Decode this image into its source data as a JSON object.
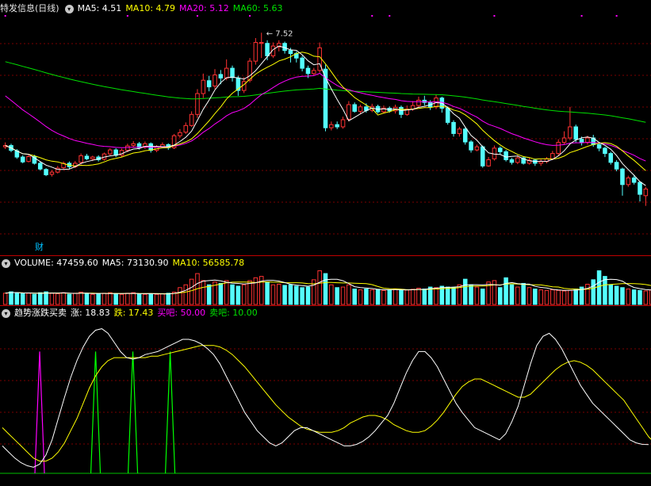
{
  "colors": {
    "up": "#ff3232",
    "down": "#54ffff",
    "ma5": "#ffffff",
    "ma10": "#ffff00",
    "ma20": "#ff00ff",
    "ma60": "#00e000",
    "grid": "#7a0000",
    "kdj_j": "#ffffff",
    "kdj_k": "#ffff00",
    "buy": "#ff00ff",
    "sell": "#00ff00"
  },
  "panel1": {
    "stock_title": "特发信息(日线)",
    "indicators": [
      {
        "label": "MA5: 4.51",
        "color": "#ffffff"
      },
      {
        "label": "MA10: 4.79",
        "color": "#ffff00"
      },
      {
        "label": "MA20: 5.12",
        "color": "#ff00ff"
      },
      {
        "label": "MA60: 5.63",
        "color": "#00e000"
      }
    ],
    "peak_label": "7.52",
    "cai_label": "财"
  },
  "panel2": {
    "indicators": [
      {
        "label": "VOLUME: 47459.60",
        "color": "#ffffff"
      },
      {
        "label": "MA5: 73130.90",
        "color": "#ffffff"
      },
      {
        "label": "MA10: 56585.78",
        "color": "#ffff00"
      }
    ]
  },
  "panel3": {
    "indicators": [
      {
        "label": "趋势涨跌买卖",
        "color": "#ffffff"
      },
      {
        "label": "涨: 18.83",
        "color": "#ffffff"
      },
      {
        "label": "跌: 17.43",
        "color": "#ffff00"
      },
      {
        "label": "买吧: 50.00",
        "color": "#ff00ff"
      },
      {
        "label": "卖吧: 10.00",
        "color": "#00e000"
      }
    ]
  },
  "chart_data": [
    {
      "type": "candlestick",
      "price_range": [
        2.9,
        7.9
      ],
      "candles": [
        {
          "o": 4.95,
          "c": 4.98,
          "h": 5.05,
          "l": 4.9
        },
        {
          "o": 4.98,
          "c": 4.87,
          "h": 5.02,
          "l": 4.83
        },
        {
          "o": 4.86,
          "c": 4.72,
          "h": 4.9,
          "l": 4.68
        },
        {
          "o": 4.72,
          "c": 4.61,
          "h": 4.76,
          "l": 4.58
        },
        {
          "o": 4.62,
          "c": 4.73,
          "h": 4.78,
          "l": 4.6
        },
        {
          "o": 4.73,
          "c": 4.58,
          "h": 4.77,
          "l": 4.55
        },
        {
          "o": 4.58,
          "c": 4.45,
          "h": 4.62,
          "l": 4.42
        },
        {
          "o": 4.44,
          "c": 4.32,
          "h": 4.47,
          "l": 4.29
        },
        {
          "o": 4.33,
          "c": 4.38,
          "h": 4.43,
          "l": 4.28
        },
        {
          "o": 4.38,
          "c": 4.47,
          "h": 4.52,
          "l": 4.35
        },
        {
          "o": 4.48,
          "c": 4.58,
          "h": 4.62,
          "l": 4.45
        },
        {
          "o": 4.58,
          "c": 4.5,
          "h": 4.62,
          "l": 4.44
        },
        {
          "o": 4.5,
          "c": 4.58,
          "h": 4.63,
          "l": 4.47
        },
        {
          "o": 4.6,
          "c": 4.75,
          "h": 4.8,
          "l": 4.55
        },
        {
          "o": 4.74,
          "c": 4.68,
          "h": 4.79,
          "l": 4.65
        },
        {
          "o": 4.68,
          "c": 4.72,
          "h": 4.75,
          "l": 4.63
        },
        {
          "o": 4.72,
          "c": 4.66,
          "h": 4.76,
          "l": 4.62
        },
        {
          "o": 4.67,
          "c": 4.79,
          "h": 4.82,
          "l": 4.64
        },
        {
          "o": 4.79,
          "c": 4.88,
          "h": 4.92,
          "l": 4.76
        },
        {
          "o": 4.88,
          "c": 4.76,
          "h": 4.92,
          "l": 4.72
        },
        {
          "o": 4.76,
          "c": 4.87,
          "h": 4.91,
          "l": 4.72
        },
        {
          "o": 4.87,
          "c": 4.97,
          "h": 5.02,
          "l": 4.83
        },
        {
          "o": 4.98,
          "c": 5.02,
          "h": 5.08,
          "l": 4.94
        },
        {
          "o": 5.02,
          "c": 4.93,
          "h": 5.06,
          "l": 4.89
        },
        {
          "o": 4.94,
          "c": 5.02,
          "h": 5.07,
          "l": 4.9
        },
        {
          "o": 5.02,
          "c": 4.87,
          "h": 5.05,
          "l": 4.82
        },
        {
          "o": 4.87,
          "c": 4.95,
          "h": 4.99,
          "l": 4.83
        },
        {
          "o": 4.95,
          "c": 5.0,
          "h": 5.05,
          "l": 4.93
        },
        {
          "o": 5.0,
          "c": 4.93,
          "h": 5.03,
          "l": 4.88
        },
        {
          "o": 4.93,
          "c": 5.2,
          "h": 5.24,
          "l": 4.9
        },
        {
          "o": 5.2,
          "c": 5.27,
          "h": 5.35,
          "l": 5.15
        },
        {
          "o": 5.28,
          "c": 5.43,
          "h": 5.5,
          "l": 5.24
        },
        {
          "o": 5.43,
          "c": 5.68,
          "h": 5.75,
          "l": 5.4
        },
        {
          "o": 5.68,
          "c": 6.15,
          "h": 6.25,
          "l": 5.6
        },
        {
          "o": 6.15,
          "c": 6.45,
          "h": 6.6,
          "l": 6.05
        },
        {
          "o": 6.44,
          "c": 6.3,
          "h": 6.55,
          "l": 6.2
        },
        {
          "o": 6.32,
          "c": 6.57,
          "h": 6.7,
          "l": 6.25
        },
        {
          "o": 6.58,
          "c": 6.5,
          "h": 6.68,
          "l": 6.36
        },
        {
          "o": 6.5,
          "c": 6.72,
          "h": 6.92,
          "l": 6.45
        },
        {
          "o": 6.72,
          "c": 6.51,
          "h": 6.78,
          "l": 6.42
        },
        {
          "o": 6.5,
          "c": 6.22,
          "h": 6.55,
          "l": 6.1
        },
        {
          "o": 6.22,
          "c": 6.42,
          "h": 6.52,
          "l": 6.16
        },
        {
          "o": 6.45,
          "c": 6.88,
          "h": 6.95,
          "l": 6.4
        },
        {
          "o": 6.88,
          "c": 7.3,
          "h": 7.4,
          "l": 6.8
        },
        {
          "o": 7.28,
          "c": 7.3,
          "h": 7.52,
          "l": 6.95
        },
        {
          "o": 7.28,
          "c": 7.0,
          "h": 7.35,
          "l": 6.9
        },
        {
          "o": 7.0,
          "c": 7.22,
          "h": 7.3,
          "l": 6.95
        },
        {
          "o": 7.2,
          "c": 7.28,
          "h": 7.35,
          "l": 7.1
        },
        {
          "o": 7.28,
          "c": 7.12,
          "h": 7.32,
          "l": 7.05
        },
        {
          "o": 7.12,
          "c": 7.05,
          "h": 7.18,
          "l": 6.85
        },
        {
          "o": 7.05,
          "c": 6.95,
          "h": 7.1,
          "l": 6.85
        },
        {
          "o": 6.95,
          "c": 6.72,
          "h": 7.0,
          "l": 6.65
        },
        {
          "o": 6.72,
          "c": 6.6,
          "h": 6.78,
          "l": 6.5
        },
        {
          "o": 6.6,
          "c": 6.67,
          "h": 6.73,
          "l": 6.55
        },
        {
          "o": 6.67,
          "c": 7.18,
          "h": 7.3,
          "l": 6.62
        },
        {
          "o": 6.7,
          "c": 5.38,
          "h": 6.8,
          "l": 5.3
        },
        {
          "o": 5.38,
          "c": 5.45,
          "h": 5.52,
          "l": 5.32
        },
        {
          "o": 5.45,
          "c": 5.4,
          "h": 5.52,
          "l": 5.35
        },
        {
          "o": 5.4,
          "c": 5.56,
          "h": 5.63,
          "l": 5.36
        },
        {
          "o": 5.57,
          "c": 5.9,
          "h": 5.98,
          "l": 5.52
        },
        {
          "o": 5.9,
          "c": 5.75,
          "h": 5.95,
          "l": 5.72
        },
        {
          "o": 5.75,
          "c": 5.85,
          "h": 5.9,
          "l": 5.7
        },
        {
          "o": 5.85,
          "c": 5.77,
          "h": 5.93,
          "l": 5.72
        },
        {
          "o": 5.77,
          "c": 5.86,
          "h": 5.92,
          "l": 5.73
        },
        {
          "o": 5.86,
          "c": 5.74,
          "h": 5.9,
          "l": 5.7
        },
        {
          "o": 5.74,
          "c": 5.82,
          "h": 5.88,
          "l": 5.7
        },
        {
          "o": 5.82,
          "c": 5.76,
          "h": 5.86,
          "l": 5.72
        },
        {
          "o": 5.76,
          "c": 5.84,
          "h": 5.9,
          "l": 5.7
        },
        {
          "o": 5.84,
          "c": 5.68,
          "h": 5.88,
          "l": 5.6
        },
        {
          "o": 5.68,
          "c": 5.8,
          "h": 5.88,
          "l": 5.65
        },
        {
          "o": 5.8,
          "c": 5.88,
          "h": 5.98,
          "l": 5.76
        },
        {
          "o": 5.88,
          "c": 6.0,
          "h": 6.08,
          "l": 5.84
        },
        {
          "o": 6.0,
          "c": 5.95,
          "h": 6.1,
          "l": 5.88
        },
        {
          "o": 5.95,
          "c": 5.85,
          "h": 6.0,
          "l": 5.78
        },
        {
          "o": 5.85,
          "c": 6.05,
          "h": 6.12,
          "l": 5.8
        },
        {
          "o": 6.05,
          "c": 5.82,
          "h": 6.08,
          "l": 5.72
        },
        {
          "o": 5.82,
          "c": 5.5,
          "h": 5.86,
          "l": 5.45
        },
        {
          "o": 5.5,
          "c": 5.25,
          "h": 5.55,
          "l": 5.18
        },
        {
          "o": 5.25,
          "c": 5.35,
          "h": 5.4,
          "l": 5.18
        },
        {
          "o": 5.35,
          "c": 5.06,
          "h": 5.38,
          "l": 5.0
        },
        {
          "o": 5.06,
          "c": 4.88,
          "h": 5.1,
          "l": 4.82
        },
        {
          "o": 4.88,
          "c": 4.95,
          "h": 5.0,
          "l": 4.85
        },
        {
          "o": 4.95,
          "c": 4.52,
          "h": 4.98,
          "l": 4.48
        },
        {
          "o": 4.52,
          "c": 4.66,
          "h": 4.72,
          "l": 4.5
        },
        {
          "o": 4.68,
          "c": 4.92,
          "h": 4.98,
          "l": 4.64
        },
        {
          "o": 4.92,
          "c": 4.84,
          "h": 4.96,
          "l": 4.78
        },
        {
          "o": 4.84,
          "c": 4.66,
          "h": 4.88,
          "l": 4.62
        },
        {
          "o": 4.66,
          "c": 4.6,
          "h": 4.7,
          "l": 4.55
        },
        {
          "o": 4.6,
          "c": 4.7,
          "h": 4.76,
          "l": 4.56
        },
        {
          "o": 4.7,
          "c": 4.58,
          "h": 4.74,
          "l": 4.55
        },
        {
          "o": 4.58,
          "c": 4.65,
          "h": 4.7,
          "l": 4.55
        },
        {
          "o": 4.65,
          "c": 4.58,
          "h": 4.68,
          "l": 4.52
        },
        {
          "o": 4.58,
          "c": 4.62,
          "h": 4.67,
          "l": 4.52
        },
        {
          "o": 4.62,
          "c": 4.68,
          "h": 4.72,
          "l": 4.58
        },
        {
          "o": 4.68,
          "c": 4.8,
          "h": 4.86,
          "l": 4.65
        },
        {
          "o": 4.8,
          "c": 5.05,
          "h": 5.12,
          "l": 4.75
        },
        {
          "o": 5.05,
          "c": 5.15,
          "h": 5.3,
          "l": 5.0
        },
        {
          "o": 5.15,
          "c": 5.4,
          "h": 5.85,
          "l": 5.1
        },
        {
          "o": 5.4,
          "c": 5.12,
          "h": 5.45,
          "l": 5.05
        },
        {
          "o": 5.12,
          "c": 5.05,
          "h": 5.18,
          "l": 4.98
        },
        {
          "o": 5.05,
          "c": 5.15,
          "h": 5.2,
          "l": 5.0
        },
        {
          "o": 5.15,
          "c": 5.0,
          "h": 5.22,
          "l": 4.95
        },
        {
          "o": 5.0,
          "c": 4.92,
          "h": 5.05,
          "l": 4.85
        },
        {
          "o": 4.92,
          "c": 4.8,
          "h": 4.95,
          "l": 4.72
        },
        {
          "o": 4.8,
          "c": 4.6,
          "h": 4.84,
          "l": 4.55
        },
        {
          "o": 4.6,
          "c": 4.45,
          "h": 4.65,
          "l": 4.4
        },
        {
          "o": 4.45,
          "c": 4.1,
          "h": 4.48,
          "l": 3.85
        },
        {
          "o": 4.1,
          "c": 4.25,
          "h": 4.3,
          "l": 4.05
        },
        {
          "o": 4.25,
          "c": 4.15,
          "h": 4.3,
          "l": 4.1
        },
        {
          "o": 4.15,
          "c": 3.88,
          "h": 4.18,
          "l": 3.72
        },
        {
          "o": 3.85,
          "c": 4.0,
          "h": 4.05,
          "l": 3.62
        }
      ]
    },
    {
      "type": "bar",
      "name": "VOLUME",
      "range": [
        0,
        130000
      ],
      "values": [
        40000,
        45000,
        42000,
        38000,
        40000,
        36000,
        42000,
        45000,
        40000,
        38000,
        42000,
        36000,
        40000,
        44000,
        38000,
        36000,
        38000,
        40000,
        42000,
        38000,
        36000,
        40000,
        42000,
        38000,
        36000,
        38000,
        36000,
        38000,
        40000,
        44000,
        60000,
        70000,
        90000,
        110000,
        85000,
        70000,
        80000,
        75000,
        85000,
        70000,
        65000,
        70000,
        85000,
        95000,
        100000,
        80000,
        70000,
        72000,
        68000,
        70000,
        65000,
        60000,
        62000,
        88000,
        120000,
        110000,
        70000,
        60000,
        62000,
        70000,
        55000,
        52000,
        55000,
        52000,
        54000,
        50000,
        52000,
        55000,
        50000,
        52000,
        54000,
        58000,
        55000,
        62000,
        60000,
        65000,
        62000,
        60000,
        70000,
        90000,
        70000,
        62000,
        55000,
        80000,
        85000,
        60000,
        95000,
        70000,
        62000,
        75000,
        60000,
        55000,
        52000,
        50000,
        52000,
        50000,
        48000,
        50000,
        55000,
        62000,
        72000,
        88000,
        120000,
        100000,
        70000,
        65000,
        60000,
        55000,
        52000,
        50000,
        48000,
        52000,
        45000,
        42000,
        40000,
        47460
      ]
    },
    {
      "type": "line",
      "name": "趋势涨跌买卖",
      "range": [
        0,
        100
      ],
      "series": [
        {
          "name": "涨",
          "values": [
            18,
            14,
            10,
            7,
            5,
            4,
            6,
            12,
            22,
            36,
            50,
            63,
            74,
            83,
            90,
            94,
            95,
            92,
            86,
            80,
            76,
            75,
            76,
            78,
            79,
            80,
            82,
            84,
            86,
            88,
            88,
            87,
            85,
            82,
            78,
            72,
            64,
            56,
            48,
            40,
            34,
            28,
            24,
            20,
            18,
            20,
            24,
            28,
            30,
            30,
            28,
            26,
            24,
            22,
            20,
            18,
            18,
            19,
            21,
            24,
            28,
            33,
            38,
            46,
            56,
            66,
            74,
            80,
            80,
            76,
            70,
            62,
            54,
            46,
            40,
            35,
            30,
            28,
            26,
            24,
            22,
            26,
            34,
            44,
            58,
            72,
            84,
            90,
            92,
            88,
            82,
            74,
            66,
            58,
            52,
            46,
            42,
            38,
            34,
            30,
            26,
            22,
            20,
            19,
            18.83
          ]
        },
        {
          "name": "跌",
          "values": [
            30,
            26,
            22,
            18,
            14,
            10,
            8,
            8,
            10,
            14,
            20,
            28,
            36,
            46,
            56,
            64,
            70,
            74,
            76,
            76,
            76,
            76,
            76,
            76,
            77,
            77,
            78,
            79,
            80,
            81,
            82,
            83,
            84,
            84,
            84,
            83,
            81,
            78,
            74,
            70,
            65,
            60,
            55,
            50,
            45,
            41,
            37,
            34,
            31,
            29,
            28,
            27,
            27,
            27,
            28,
            30,
            33,
            35,
            37,
            38,
            38,
            37,
            35,
            32,
            30,
            28,
            27,
            27,
            28,
            31,
            35,
            40,
            46,
            52,
            57,
            60,
            62,
            62,
            60,
            58,
            56,
            54,
            52,
            50,
            50,
            52,
            56,
            60,
            64,
            68,
            71,
            73,
            74,
            73,
            71,
            68,
            64,
            60,
            56,
            52,
            48,
            42,
            36,
            30,
            24,
            20,
            17.43
          ]
        }
      ],
      "buy_signals": [
        6
      ],
      "sell_signals": [
        15,
        21,
        27
      ]
    }
  ]
}
